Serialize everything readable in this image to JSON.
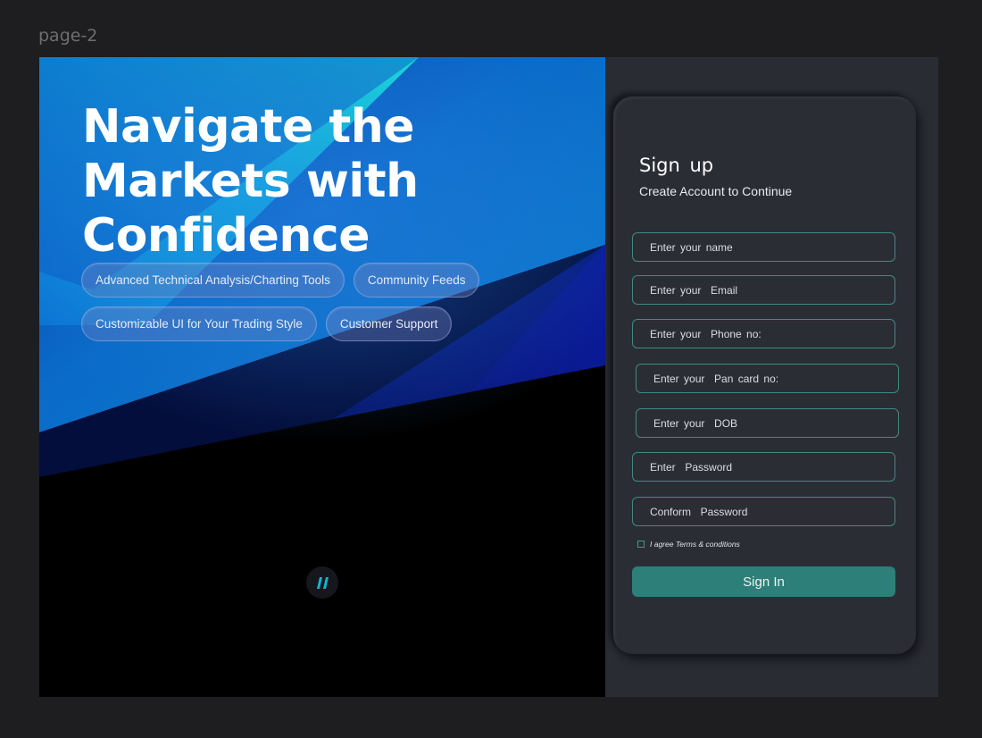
{
  "frame": {
    "label": "page-2"
  },
  "hero": {
    "title_lines": [
      "Navigate the",
      "Markets with",
      "Confidence"
    ],
    "chips": [
      "Advanced Technical Analysis/Charting Tools",
      "Community Feeds",
      "Customizable UI for Your Trading Style",
      "Customer Support"
    ],
    "quote_icon": "quote-icon"
  },
  "signup": {
    "title": "Sign  up",
    "subtitle": "Create Account to Continue",
    "fields": {
      "name": "Enter your name",
      "email": "Enter your  Email",
      "phone": "Enter your  Phone no:",
      "pan": "Enter your  Pan card no:",
      "dob": "Enter your  DOB",
      "password": "Enter  Password",
      "confirm_password": "Conform  Password"
    },
    "terms_label": "I agree Terms & conditions",
    "submit_label": "Sign In"
  },
  "colors": {
    "accent": "#2d7f79",
    "field_border": "#3f8a80",
    "card_bg": "#2b2d35",
    "hero_cyan": "#16f0d8",
    "hero_blue": "#0a5fc4"
  }
}
